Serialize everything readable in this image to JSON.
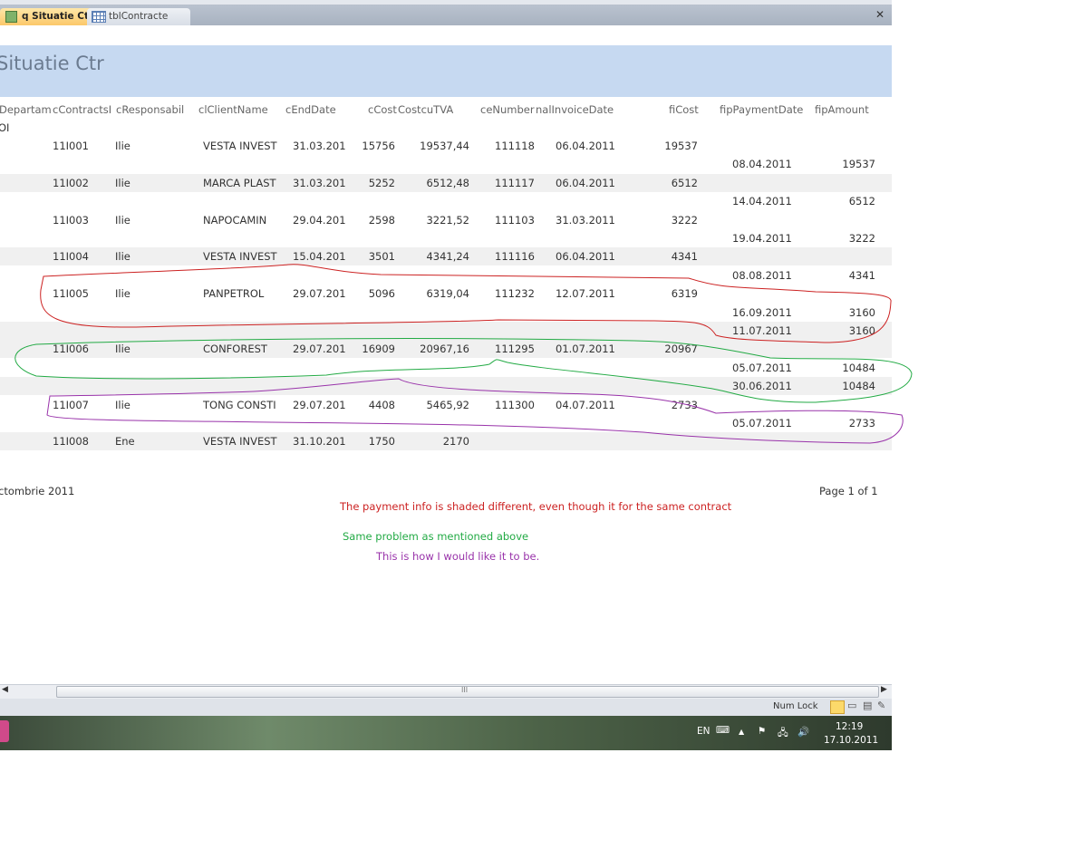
{
  "tabs": [
    {
      "label": "q Situatie Ctr",
      "active": true
    },
    {
      "label": "tblContracte",
      "active": false
    }
  ],
  "report_title": "Situatie Ctr",
  "headers": {
    "dept": "Departam",
    "contract": "cContractsI",
    "resp": "cResponsabil",
    "client": "clClientName",
    "enddate": "cEndDate",
    "cost": "cCost",
    "costtva": "CostcuTVA",
    "invnum": "ceNumber",
    "invdate": "nalInvoiceDate",
    "ficost": "fiCost",
    "paydate": "fipPaymentDate",
    "amount": "fipAmount"
  },
  "group_label": "OI",
  "rows": [
    {
      "contract": "11I001",
      "resp": "Ilie",
      "client": "VESTA INVEST",
      "enddate": "31.03.201",
      "cost": "15756",
      "costtva": "19537,44",
      "invnum": "111118",
      "invdate": "06.04.2011",
      "ficost": "19537",
      "paydate": "",
      "amount": "",
      "shaded": false
    },
    {
      "paydate": "08.04.2011",
      "amount": "19537",
      "shaded": false
    },
    {
      "contract": "11I002",
      "resp": "Ilie",
      "client": "MARCA PLAST",
      "enddate": "31.03.201",
      "cost": "5252",
      "costtva": "6512,48",
      "invnum": "111117",
      "invdate": "06.04.2011",
      "ficost": "6512",
      "shaded": true
    },
    {
      "paydate": "14.04.2011",
      "amount": "6512",
      "shaded": false
    },
    {
      "contract": "11I003",
      "resp": "Ilie",
      "client": "NAPOCAMIN",
      "enddate": "29.04.201",
      "cost": "2598",
      "costtva": "3221,52",
      "invnum": "111103",
      "invdate": "31.03.2011",
      "ficost": "3222",
      "shaded": false
    },
    {
      "paydate": "19.04.2011",
      "amount": "3222",
      "shaded": false
    },
    {
      "contract": "11I004",
      "resp": "Ilie",
      "client": "VESTA INVEST",
      "enddate": "15.04.201",
      "cost": "3501",
      "costtva": "4341,24",
      "invnum": "111116",
      "invdate": "06.04.2011",
      "ficost": "4341",
      "shaded": true
    },
    {
      "paydate": "08.08.2011",
      "amount": "4341",
      "shaded": false
    },
    {
      "contract": "11I005",
      "resp": "Ilie",
      "client": "PANPETROL",
      "enddate": "29.07.201",
      "cost": "5096",
      "costtva": "6319,04",
      "invnum": "111232",
      "invdate": "12.07.2011",
      "ficost": "6319",
      "shaded": false
    },
    {
      "paydate": "16.09.2011",
      "amount": "3160",
      "shaded": false
    },
    {
      "paydate": "11.07.2011",
      "amount": "3160",
      "shaded": true
    },
    {
      "contract": "11I006",
      "resp": "Ilie",
      "client": "CONFOREST",
      "enddate": "29.07.201",
      "cost": "16909",
      "costtva": "20967,16",
      "invnum": "111295",
      "invdate": "01.07.2011",
      "ficost": "20967",
      "shaded": true
    },
    {
      "paydate": "05.07.2011",
      "amount": "10484",
      "shaded": false
    },
    {
      "paydate": "30.06.2011",
      "amount": "10484",
      "shaded": true
    },
    {
      "contract": "11I007",
      "resp": "Ilie",
      "client": "TONG CONSTI",
      "enddate": "29.07.201",
      "cost": "4408",
      "costtva": "5465,92",
      "invnum": "111300",
      "invdate": "04.07.2011",
      "ficost": "2733",
      "shaded": false
    },
    {
      "paydate": "05.07.2011",
      "amount": "2733",
      "shaded": false
    },
    {
      "contract": "11I008",
      "resp": "Ene",
      "client": "VESTA INVEST",
      "enddate": "31.10.201",
      "cost": "1750",
      "costtva": "2170",
      "shaded": true
    }
  ],
  "footer": {
    "date": "ctombrie 2011",
    "page": "Page 1 of 1"
  },
  "notes": {
    "red": "The payment info is shaded different, even though it for the same contract",
    "green": "Same problem as mentioned above",
    "purple": "This is how I would like it to be."
  },
  "colors": {
    "red": "#cc2222",
    "green": "#22aa44",
    "purple": "#9933aa"
  },
  "status": {
    "numlock": "Num Lock",
    "hscroll_grip": "III"
  },
  "tray": {
    "lang": "EN",
    "time": "12:19",
    "date": "17.10.2011"
  }
}
